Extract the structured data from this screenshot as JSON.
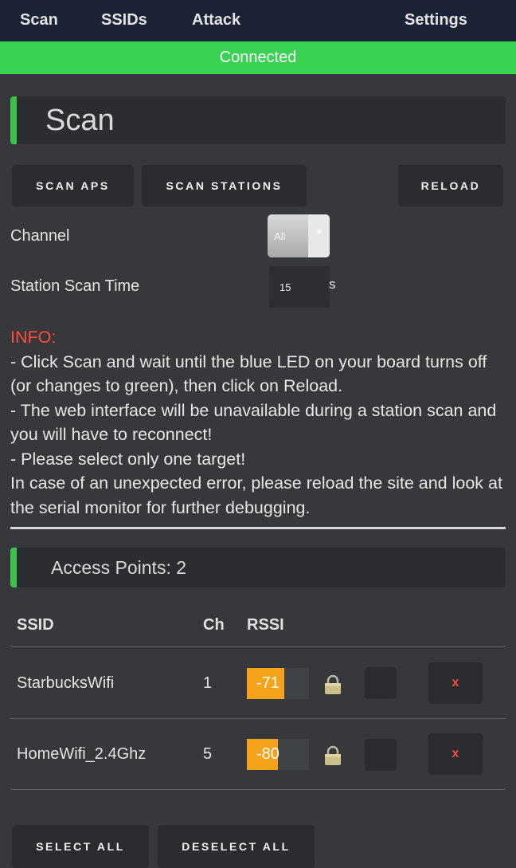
{
  "nav": {
    "scan": "Scan",
    "ssids": "SSIDs",
    "attack": "Attack",
    "settings": "Settings"
  },
  "status": "Connected",
  "scan_panel": {
    "title": "Scan"
  },
  "buttons": {
    "scan_aps": "SCAN APS",
    "scan_stations": "SCAN STATIONS",
    "reload": "RELOAD",
    "select_all": "SELECT ALL",
    "deselect_all": "DESELECT ALL"
  },
  "channel": {
    "label": "Channel",
    "value": "All"
  },
  "scan_time": {
    "label": "Station Scan Time",
    "value": "15",
    "unit": "s"
  },
  "info": {
    "heading": "INFO:",
    "lines": [
      "- Click Scan and wait until the blue LED on your board turns off (or changes to green), then click on Reload.",
      "- The web interface will be unavailable during a station scan and you will have to reconnect!",
      "- Please select only one target!",
      "In case of an unexpected error, please reload the site and look at the serial monitor for further debugging."
    ]
  },
  "ap_panel": {
    "title": "Access Points: 2"
  },
  "table": {
    "headers": [
      "SSID",
      "Ch",
      "RSSI"
    ],
    "rows": [
      {
        "ssid": "StarbucksWifi",
        "ch": "1",
        "rssi": "-71",
        "signal_fraction": 0.6,
        "encrypted": true,
        "delete": "x"
      },
      {
        "ssid": "HomeWifi_2.4Ghz",
        "ch": "5",
        "rssi": "-80",
        "signal_fraction": 0.5,
        "encrypted": true,
        "delete": "x"
      }
    ]
  },
  "colors": {
    "accent_green": "#3cc24b",
    "status_green": "#3ad252",
    "nav_bg": "#1c2235",
    "rssi_orange": "#f5a31b",
    "info_red": "#ff4d3d"
  }
}
